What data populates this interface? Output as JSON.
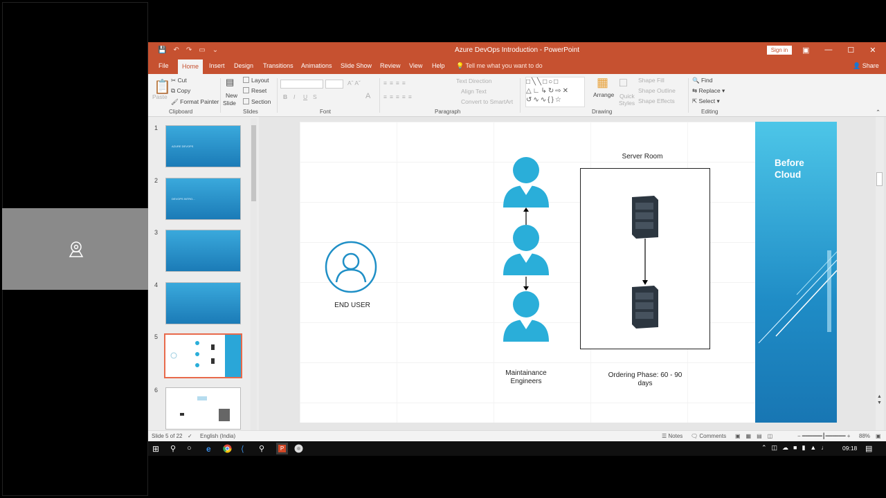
{
  "window": {
    "title": "Azure DevOps Introduction  -  PowerPoint",
    "sign_in": "Sign in",
    "controls": [
      "—",
      "☐",
      "✕"
    ]
  },
  "tabs": [
    "File",
    "Home",
    "Insert",
    "Design",
    "Transitions",
    "Animations",
    "Slide Show",
    "Review",
    "View",
    "Help"
  ],
  "tell_me": "Tell me what you want to do",
  "share": "Share",
  "ribbon": {
    "clipboard": {
      "paste": "Paste",
      "cut": "Cut",
      "copy": "Copy",
      "format_painter": "Format Painter",
      "label": "Clipboard"
    },
    "slides": {
      "new_slide": "New",
      "new_slide2": "Slide",
      "layout": "Layout",
      "reset": "Reset",
      "section": "Section",
      "label": "Slides"
    },
    "font": {
      "label": "Font",
      "bold": "B",
      "italic": "I",
      "underline": "U",
      "strike": "S"
    },
    "paragraph": {
      "label": "Paragraph",
      "text_direction": "Text Direction",
      "align_text": "Align Text",
      "smartart": "Convert to SmartArt"
    },
    "drawing": {
      "label": "Drawing",
      "arrange": "Arrange",
      "quick_styles": "Quick",
      "quick_styles2": "Styles",
      "shape_fill": "Shape Fill",
      "shape_outline": "Shape Outline",
      "shape_effects": "Shape Effects"
    },
    "editing": {
      "label": "Editing",
      "find": "Find",
      "replace": "Replace",
      "select": "Select"
    }
  },
  "thumbnails": [
    {
      "num": "1",
      "text": "AZURE DEVOPS"
    },
    {
      "num": "2",
      "text": "DEVOPS INTRO..."
    },
    {
      "num": "3",
      "text": ""
    },
    {
      "num": "4",
      "text": ""
    },
    {
      "num": "5",
      "text": ""
    },
    {
      "num": "6",
      "text": ""
    }
  ],
  "slide": {
    "end_user": "END USER",
    "server_room": "Server Room",
    "engineers": "Maintainance\nEngineers",
    "ordering": "Ordering Phase: 60 - 90\ndays",
    "side_title": "Before\nCloud"
  },
  "status": {
    "slide_count": "Slide 5 of 22",
    "language": "English (India)",
    "notes": "Notes",
    "comments": "Comments",
    "zoom": "88%"
  },
  "taskbar": {
    "time": "09:18"
  },
  "colors": {
    "ppt_accent": "#c65130",
    "slide_blue": "#2aa6d8",
    "person_blue": "#2aaed9"
  }
}
